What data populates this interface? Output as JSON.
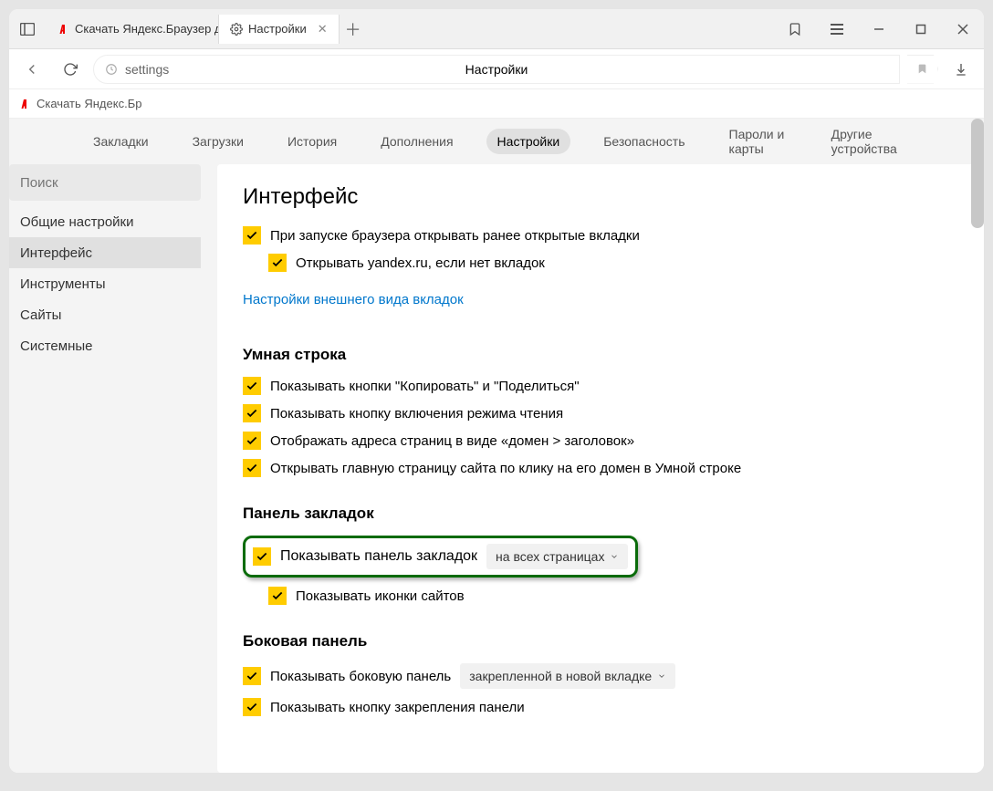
{
  "tabs": [
    {
      "title": "Скачать Яндекс.Браузер д"
    },
    {
      "title": "Настройки"
    }
  ],
  "address": {
    "text": "settings",
    "title": "Настройки"
  },
  "bookmarks_bar_item": "Скачать Яндекс.Бр",
  "topnav": {
    "bookmarks": "Закладки",
    "downloads": "Загрузки",
    "history": "История",
    "addons": "Дополнения",
    "settings": "Настройки",
    "security": "Безопасность",
    "passwords": "Пароли и карты",
    "devices": "Другие устройства"
  },
  "sidebar": {
    "search_placeholder": "Поиск",
    "items": {
      "general": "Общие настройки",
      "interface": "Интерфейс",
      "tools": "Инструменты",
      "sites": "Сайты",
      "system": "Системные"
    }
  },
  "panel": {
    "heading": "Интерфейс",
    "restore_tabs": "При запуске браузера открывать ранее открытые вкладки",
    "open_yandex": "Открывать yandex.ru, если нет вкладок",
    "tabs_appearance_link": "Настройки внешнего вида вкладок",
    "smart_line_heading": "Умная строка",
    "smart1": "Показывать кнопки \"Копировать\" и \"Поделиться\"",
    "smart2": "Показывать кнопку включения режима чтения",
    "smart3": "Отображать адреса страниц в виде «домен > заголовок»",
    "smart4": "Открывать главную страницу сайта по клику на его домен в Умной строке",
    "bookmarks_panel_heading": "Панель закладок",
    "show_bookmarks_panel": "Показывать панель закладок",
    "bookmarks_select": "на всех страницах",
    "show_site_icons": "Показывать иконки сайтов",
    "side_panel_heading": "Боковая панель",
    "show_side_panel": "Показывать боковую панель",
    "side_panel_select": "закрепленной в новой вкладке",
    "show_pin_button": "Показывать кнопку закрепления панели"
  }
}
